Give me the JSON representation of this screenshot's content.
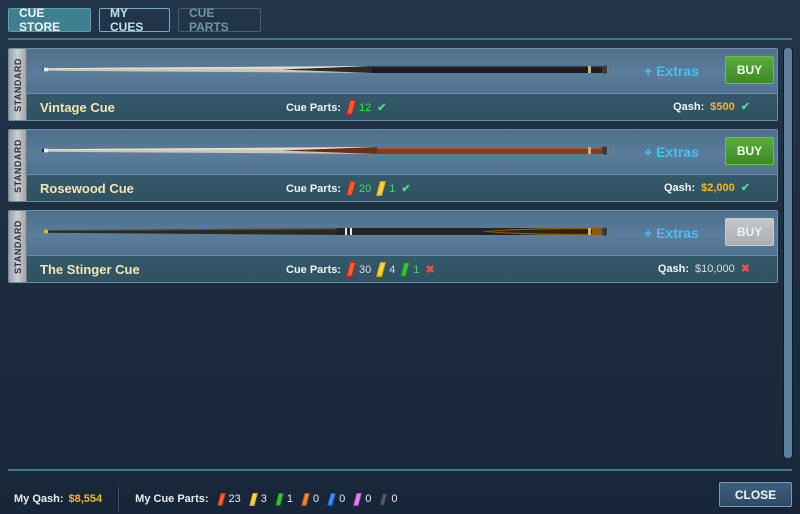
{
  "tabs": [
    {
      "label": "CUE STORE",
      "state": "active"
    },
    {
      "label": "MY CUES",
      "state": "normal"
    },
    {
      "label": "CUE PARTS",
      "state": "disabled"
    }
  ],
  "cues": [
    {
      "badge": "STANDARD",
      "name": "Vintage Cue",
      "extras_label": "+ Extras",
      "buy_label": "BUY",
      "buy_enabled": true,
      "parts_label": "Cue Parts:",
      "parts": [
        {
          "color": "red",
          "count": "12",
          "count_color": "#3fe05a"
        }
      ],
      "parts_status": "✔",
      "qash_label": "Qash:",
      "qash_value": "$500",
      "qash_status": "✔",
      "cue_style": "dark"
    },
    {
      "badge": "STANDARD",
      "name": "Rosewood Cue",
      "extras_label": "+ Extras",
      "buy_label": "BUY",
      "buy_enabled": true,
      "parts_label": "Cue Parts:",
      "parts": [
        {
          "color": "red",
          "count": "20",
          "count_color": "#3fe05a"
        },
        {
          "color": "yellow",
          "count": "1",
          "count_color": "#3fe05a"
        }
      ],
      "parts_status": "✔",
      "qash_label": "Qash:",
      "qash_value": "$2,000",
      "qash_status": "✔",
      "cue_style": "rosewood"
    },
    {
      "badge": "STANDARD",
      "name": "The Stinger Cue",
      "extras_label": "+ Extras",
      "buy_label": "BUY",
      "buy_enabled": false,
      "parts_label": "Cue Parts:",
      "parts": [
        {
          "color": "red",
          "count": "30",
          "count_color": "#d7dde2"
        },
        {
          "color": "yellow",
          "count": "4",
          "count_color": "#d7dde2"
        },
        {
          "color": "green",
          "count": "1",
          "count_color": "#3fe05a"
        }
      ],
      "parts_status": "✖",
      "qash_label": "Qash:",
      "qash_value": "$10,000",
      "qash_status": "✖",
      "cue_style": "stinger"
    }
  ],
  "footer": {
    "qash_label": "My Qash:",
    "qash_value": "$8,554",
    "parts_label": "My Cue Parts:",
    "parts": [
      {
        "color": "red",
        "count": "23"
      },
      {
        "color": "yellow",
        "count": "3"
      },
      {
        "color": "green",
        "count": "1"
      },
      {
        "color": "orange",
        "count": "0"
      },
      {
        "color": "blue",
        "count": "0"
      },
      {
        "color": "pink",
        "count": "0"
      },
      {
        "color": "black",
        "count": "0"
      }
    ],
    "close_label": "CLOSE"
  },
  "colors": {
    "gold": "#f6b71c",
    "green_count": "#3fe05a",
    "extras": "#46c0f0",
    "buy_green": "#4e9e33"
  }
}
